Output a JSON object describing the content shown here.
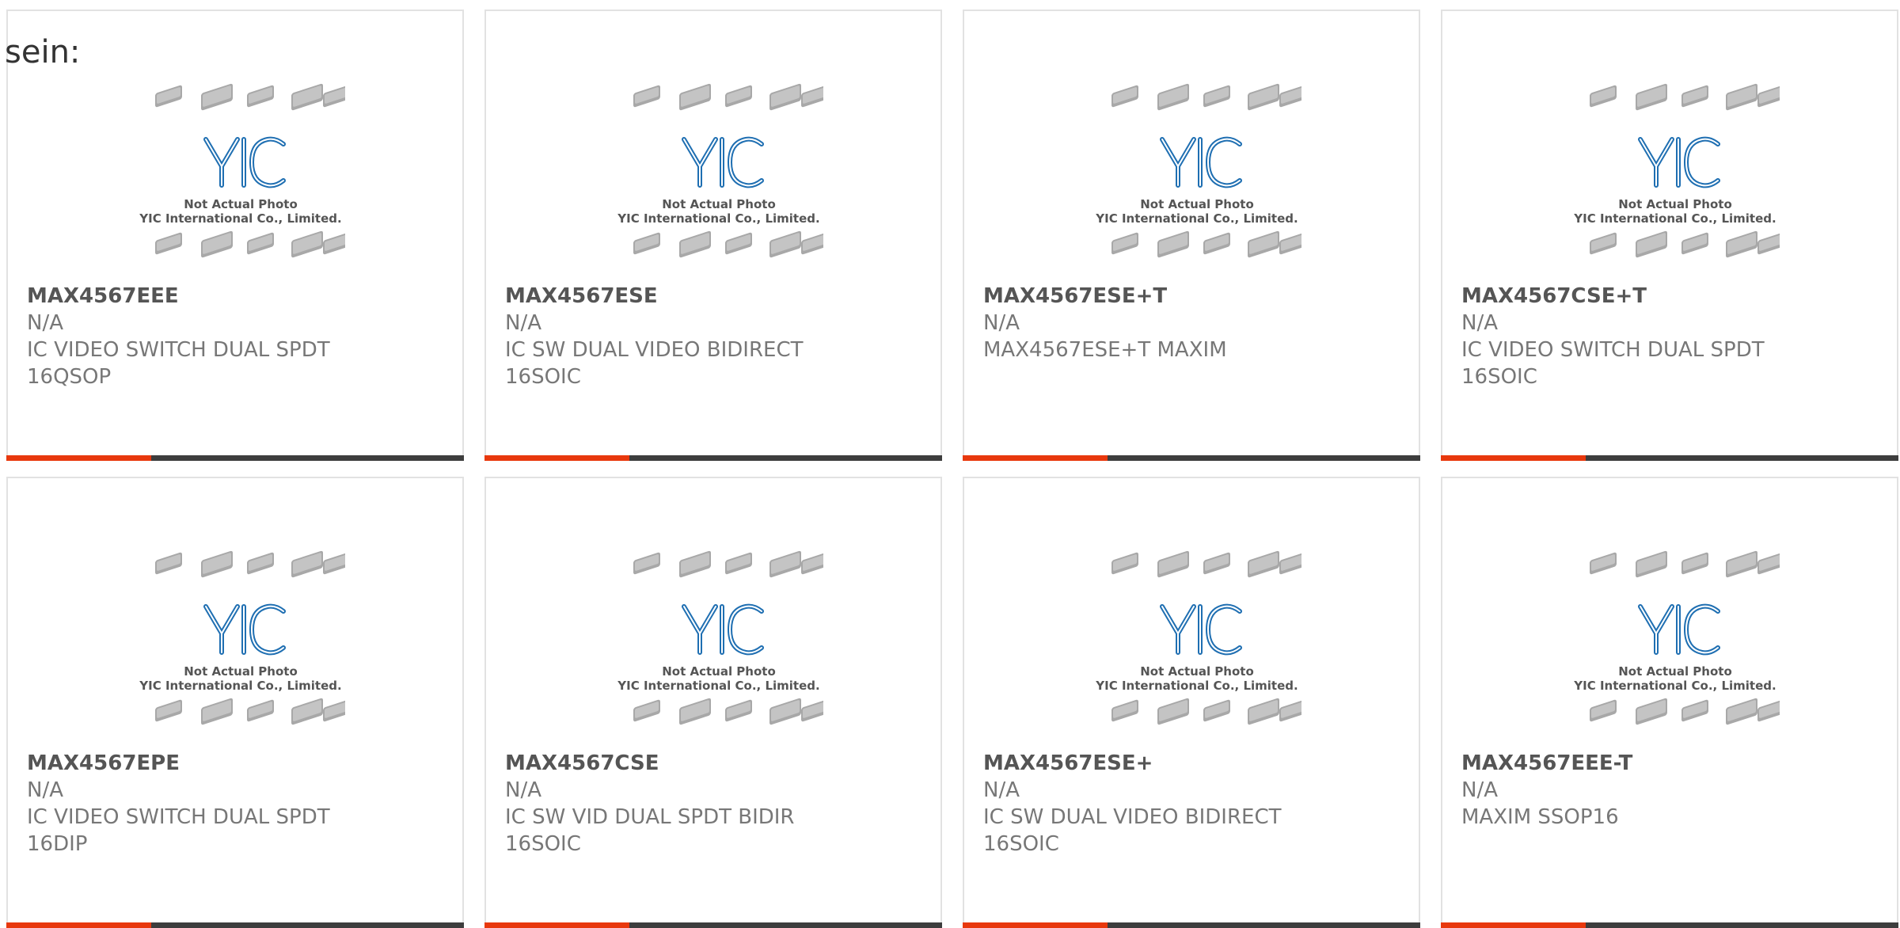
{
  "page": {
    "label": "sein:"
  },
  "placeholder": {
    "caption_line1": "Not Actual Photo",
    "caption_line2": "YIC International Co., Limited.",
    "logo_text": "YIC"
  },
  "products": [
    {
      "part": "MAX4567EEE",
      "manufacturer": "N/A",
      "desc1": "IC VIDEO SWITCH DUAL SPDT",
      "desc2": "16QSOP"
    },
    {
      "part": "MAX4567ESE",
      "manufacturer": "N/A",
      "desc1": "IC SW DUAL VIDEO BIDIRECT",
      "desc2": "16SOIC"
    },
    {
      "part": "MAX4567ESE+T",
      "manufacturer": "N/A",
      "desc1": "MAX4567ESE+T MAXIM",
      "desc2": ""
    },
    {
      "part": "MAX4567CSE+T",
      "manufacturer": "N/A",
      "desc1": "IC VIDEO SWITCH DUAL SPDT",
      "desc2": "16SOIC"
    },
    {
      "part": "MAX4567EPE",
      "manufacturer": "N/A",
      "desc1": "IC VIDEO SWITCH DUAL SPDT",
      "desc2": "16DIP"
    },
    {
      "part": "MAX4567CSE",
      "manufacturer": "N/A",
      "desc1": "IC SW VID DUAL SPDT BIDIR",
      "desc2": "16SOIC"
    },
    {
      "part": "MAX4567ESE+",
      "manufacturer": "N/A",
      "desc1": "IC SW DUAL VIDEO BIDIRECT",
      "desc2": "16SOIC"
    },
    {
      "part": "MAX4567EEE-T",
      "manufacturer": "N/A",
      "desc1": "MAXIM SSOP16",
      "desc2": ""
    }
  ],
  "colors": {
    "accent": "#e8380d",
    "bar": "#3d3d3d",
    "logo": "#1f6fb2",
    "border": "#e2e2e2"
  }
}
